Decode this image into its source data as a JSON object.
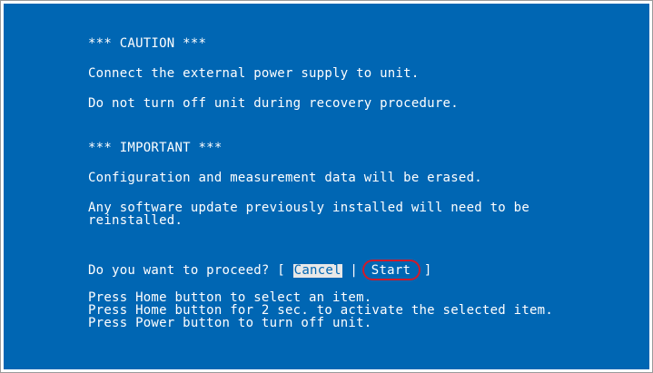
{
  "caution": {
    "heading": "*** CAUTION ***",
    "line1": "Connect the external power supply to unit.",
    "line2": "Do not turn off unit during recovery procedure."
  },
  "important": {
    "heading": "*** IMPORTANT ***",
    "line1": "Configuration and measurement data will be erased.",
    "line2a": "Any software update previously installed will need to be",
    "line2b": "reinstalled."
  },
  "prompt": {
    "question": "Do you want to proceed? [ ",
    "cancel_label": "Cancel",
    "separator": " | ",
    "start_label": "Start",
    "close_bracket": " ]"
  },
  "instructions": {
    "line1": "Press Home button to select an item.",
    "line2": "Press Home button for 2 sec. to activate the selected item.",
    "line3": "Press Power button to turn off unit."
  },
  "colors": {
    "screen_background": "#0066b3",
    "text": "#ffffff",
    "selection_background": "#e8e8e8",
    "highlight_circle": "#d11a2a"
  }
}
